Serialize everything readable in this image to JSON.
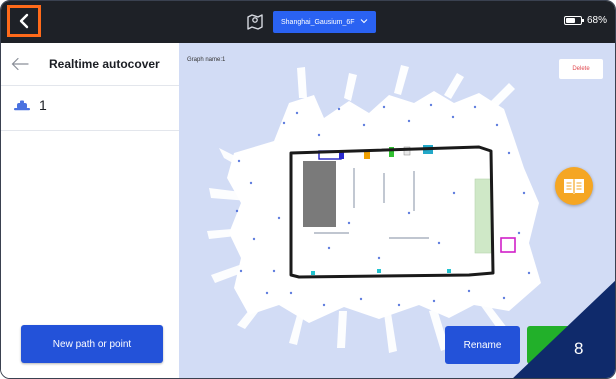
{
  "topbar": {
    "map_name": "Shanghai_Gausium_6F",
    "battery_percent": "68%",
    "battery_level": 0.68
  },
  "left_panel": {
    "title": "Realtime autocover",
    "route_number": "1",
    "new_path_label": "New path or point"
  },
  "map": {
    "graph_name": "Graph name:1",
    "delete_label": "Delete",
    "rename_label": "Rename"
  },
  "step_badge": "8",
  "colors": {
    "topbar": "#1e2127",
    "accent_blue": "#2352d9",
    "highlight_orange": "#ff6a1a",
    "book_orange": "#f5a623",
    "green": "#22b02a",
    "badge_navy": "#0f2a6b"
  },
  "icons": [
    "back-icon",
    "map-location-icon",
    "chevron-down-icon",
    "battery-icon",
    "arrow-left-icon",
    "robot-route-icon",
    "book-icon"
  ]
}
